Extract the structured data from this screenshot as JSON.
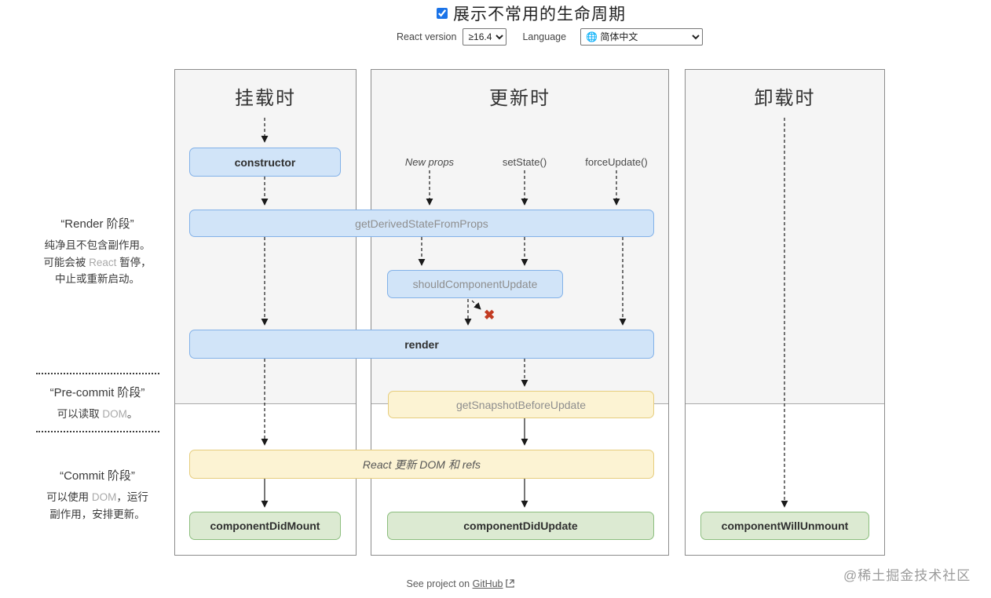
{
  "header": {
    "show_uncommon_label": "展示不常用的生命周期",
    "checkbox_checked": true,
    "react_version_label": "React version",
    "react_version_value": "≥16.4",
    "language_label": "Language",
    "language_value": "🌐 简体中文"
  },
  "sidebar": {
    "sections": [
      {
        "title": "“Render 阶段”",
        "lines": [
          [
            {
              "t": "纯净且不包含副作用。"
            }
          ],
          [
            {
              "t": "可能会被 "
            },
            {
              "t": "React",
              "muted": true
            },
            {
              "t": " 暂停，"
            }
          ],
          [
            {
              "t": "中止或重新启动。"
            }
          ]
        ]
      },
      {
        "title": "“Pre-commit 阶段”",
        "lines": [
          [
            {
              "t": "可以读取 "
            },
            {
              "t": "DOM",
              "muted": true
            },
            {
              "t": "。"
            }
          ]
        ]
      },
      {
        "title": "“Commit 阶段”",
        "lines": [
          [
            {
              "t": "可以使用 "
            },
            {
              "t": "DOM",
              "muted": true
            },
            {
              "t": "，运行"
            }
          ],
          [
            {
              "t": "副作用，安排更新。"
            }
          ]
        ]
      }
    ]
  },
  "columns": {
    "mounting": "挂载时",
    "updating": "更新时",
    "unmounting": "卸载时"
  },
  "triggers": {
    "new_props": "New props",
    "set_state": "setState()",
    "force_update": "forceUpdate()"
  },
  "boxes": {
    "constructor": "constructor",
    "get_derived_state_from_props": "getDerivedStateFromProps",
    "should_component_update": "shouldComponentUpdate",
    "render": "render",
    "get_snapshot_before_update": "getSnapshotBeforeUpdate",
    "react_updates_dom": "React 更新 DOM 和 refs",
    "component_did_mount": "componentDidMount",
    "component_did_update": "componentDidUpdate",
    "component_will_unmount": "componentWillUnmount"
  },
  "icons": {
    "cancel_x": "✖"
  },
  "footer": {
    "text_before_link": "See project on",
    "link_label": "GitHub"
  },
  "watermark": "@稀土掘金技术社区",
  "colors": {
    "blue_box_bg": "#d1e4f8",
    "blue_box_border": "#82b1e8",
    "yellow_box_bg": "#fcf3d3",
    "yellow_box_border": "#e6cd7e",
    "green_box_bg": "#dcead2",
    "green_box_border": "#8cbe7e",
    "panel_gray_bg": "#f5f5f5",
    "error_red": "#c23b22",
    "checkbox_blue": "#1a73e8"
  }
}
